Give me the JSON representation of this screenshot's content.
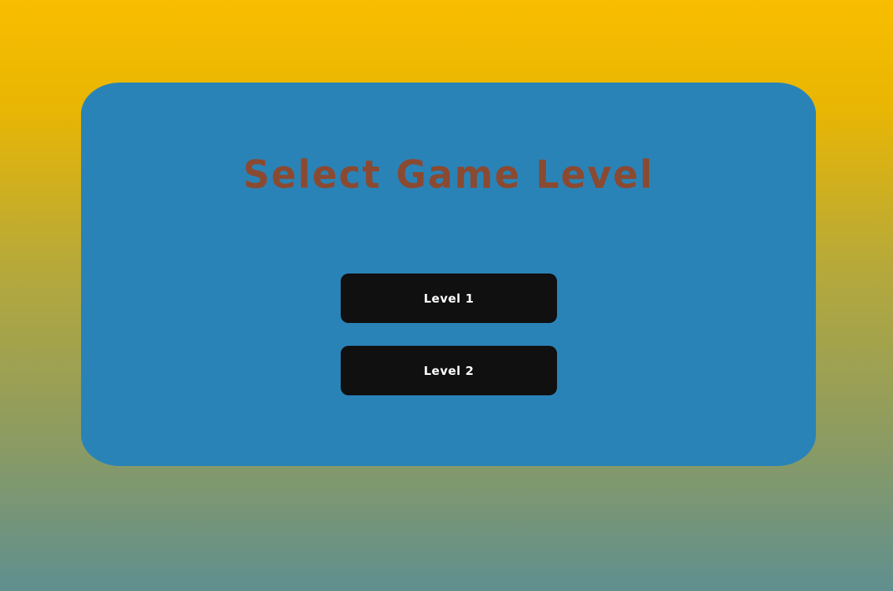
{
  "colors": {
    "background_top": "#f8bd00",
    "background_bottom": "#5f8f8f",
    "panel": "#2a83b7",
    "title": "#8a4a32",
    "button_bg": "#101010",
    "button_text": "#ffffff"
  },
  "screen": {
    "title": "Select Game Level"
  },
  "levels": [
    {
      "label": "Level 1"
    },
    {
      "label": "Level 2"
    }
  ]
}
